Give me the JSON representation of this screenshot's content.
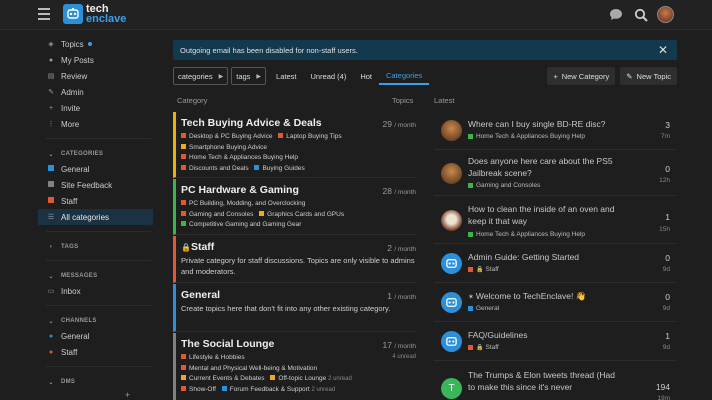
{
  "header": {
    "logo_line1": "tech",
    "logo_line2": "enclave"
  },
  "sidebar": {
    "items": [
      {
        "label": "Topics",
        "icon": "layers-icon"
      },
      {
        "label": "My Posts",
        "icon": "user-icon"
      },
      {
        "label": "Review",
        "icon": "review-icon"
      },
      {
        "label": "Admin",
        "icon": "wrench-icon"
      },
      {
        "label": "Invite",
        "icon": "user-plus-icon"
      },
      {
        "label": "More",
        "icon": "more-icon"
      }
    ],
    "categories_heading": "CATEGORIES",
    "categories": [
      {
        "label": "General",
        "color": "#2b8fd9"
      },
      {
        "label": "Site Feedback",
        "color": "#808281"
      },
      {
        "label": "Staff",
        "color": "#e45735"
      },
      {
        "label": "All categories",
        "icon": "all-categories-icon"
      }
    ],
    "tags_heading": "TAGS",
    "messages_heading": "MESSAGES",
    "messages": [
      {
        "label": "Inbox"
      }
    ],
    "channels_heading": "CHANNELS",
    "channels": [
      {
        "label": "General",
        "color": "#2b8fd9"
      },
      {
        "label": "Staff",
        "color": "#e45735"
      }
    ],
    "dms_heading": "DMS"
  },
  "notice": {
    "text": "Outgoing email has been disabled for non-staff users."
  },
  "nav": {
    "categories_dropdown": "categories",
    "tags_dropdown": "tags",
    "links": [
      "Latest",
      "Unread (4)",
      "Hot",
      "Categories"
    ],
    "new_category": "New Category",
    "new_topic": "New Topic"
  },
  "columns": {
    "category": "Category",
    "topics": "Topics",
    "latest": "Latest"
  },
  "categories": [
    {
      "title": "Tech Buying Advice & Deals",
      "count": "29",
      "period": "/ month",
      "color": "#e8b400",
      "subs": [
        {
          "label": "Desktop & PC Buying Advice",
          "color": "#e45735"
        },
        {
          "label": "Laptop Buying Tips",
          "color": "#e45735"
        },
        {
          "label": "Smartphone Buying Advice",
          "color": "#f1a81e"
        },
        {
          "label": "Home Tech & Appliances Buying Help",
          "color": "#e45735"
        },
        {
          "label": "Discounts and Deals",
          "color": "#e45735"
        },
        {
          "label": "Buying Guides",
          "color": "#2b8fd9"
        }
      ]
    },
    {
      "title": "PC Hardware & Gaming",
      "count": "28",
      "period": "/ month",
      "color": "#3ab54a",
      "subs": [
        {
          "label": "PC Building, Modding, and Overclocking",
          "color": "#e45735"
        },
        {
          "label": "Gaming and Consoles",
          "color": "#e45735"
        },
        {
          "label": "Graphics Cards and GPUs",
          "color": "#f1a81e"
        },
        {
          "label": "Competitive Gaming and Gaming Gear",
          "color": "#3ab54a"
        }
      ]
    },
    {
      "title": "Staff",
      "count": "2",
      "period": "/ month",
      "color": "#e45735",
      "description": "Private category for staff discussions. Topics are only visible to admins and moderators."
    },
    {
      "title": "General",
      "count": "1",
      "period": "/ month",
      "color": "#2b8fd9",
      "description": "Create topics here that don't fit into any other existing category."
    },
    {
      "title": "The Social Lounge",
      "count": "17",
      "period": "/ month",
      "unread": "4 unread",
      "color": "#808281",
      "subs": [
        {
          "label": "Lifestyle & Hobbies",
          "color": "#e45735"
        },
        {
          "label": "Mental and Physical Well-being & Motivation",
          "color": "#e45735"
        },
        {
          "label": "Current Events & Debates",
          "color": "#f1a81e"
        },
        {
          "label": "Off-topic Lounge",
          "color": "#f1a81e",
          "unread": "2 unread"
        },
        {
          "label": "Show-Off",
          "color": "#e45735"
        },
        {
          "label": "Forum Feedback & Support",
          "color": "#2b8fd9",
          "unread": "2 unread"
        }
      ]
    }
  ],
  "latest": [
    {
      "title": "Where can I buy single BD-RE disc?",
      "category": "Home Tech & Appliances Buying Help",
      "cat_color": "#3ab54a",
      "count": "3",
      "age": "7m",
      "avatar": "stone"
    },
    {
      "title": "Does anyone here care about the PS5 Jailbreak scene?",
      "category": "Gaming and Consoles",
      "cat_color": "#3ab54a",
      "count": "0",
      "age": "12h",
      "avatar": "stone"
    },
    {
      "title": "How to clean the inside of an oven and keep it that way",
      "category": "Home Tech & Appliances Buying Help",
      "cat_color": "#3ab54a",
      "count": "1",
      "age": "15h",
      "avatar": "round"
    },
    {
      "title": "Admin Guide: Getting Started",
      "category": "Staff",
      "cat_color": "#e45735",
      "locked": true,
      "count": "0",
      "age": "9d",
      "avatar": "te"
    },
    {
      "title": "Welcome to TechEnclave! 👋",
      "category": "General",
      "cat_color": "#2b8fd9",
      "pinned": true,
      "count": "0",
      "age": "9d",
      "avatar": "te"
    },
    {
      "title": "FAQ/Guidelines",
      "category": "Staff",
      "cat_color": "#e45735",
      "locked": true,
      "count": "1",
      "age": "9d",
      "avatar": "te"
    },
    {
      "title": "The Trumps & Elon tweets thread (Had to make this since it's never",
      "count": "194",
      "age": "19m",
      "avatar": "green",
      "avatar_letter": "T"
    }
  ]
}
